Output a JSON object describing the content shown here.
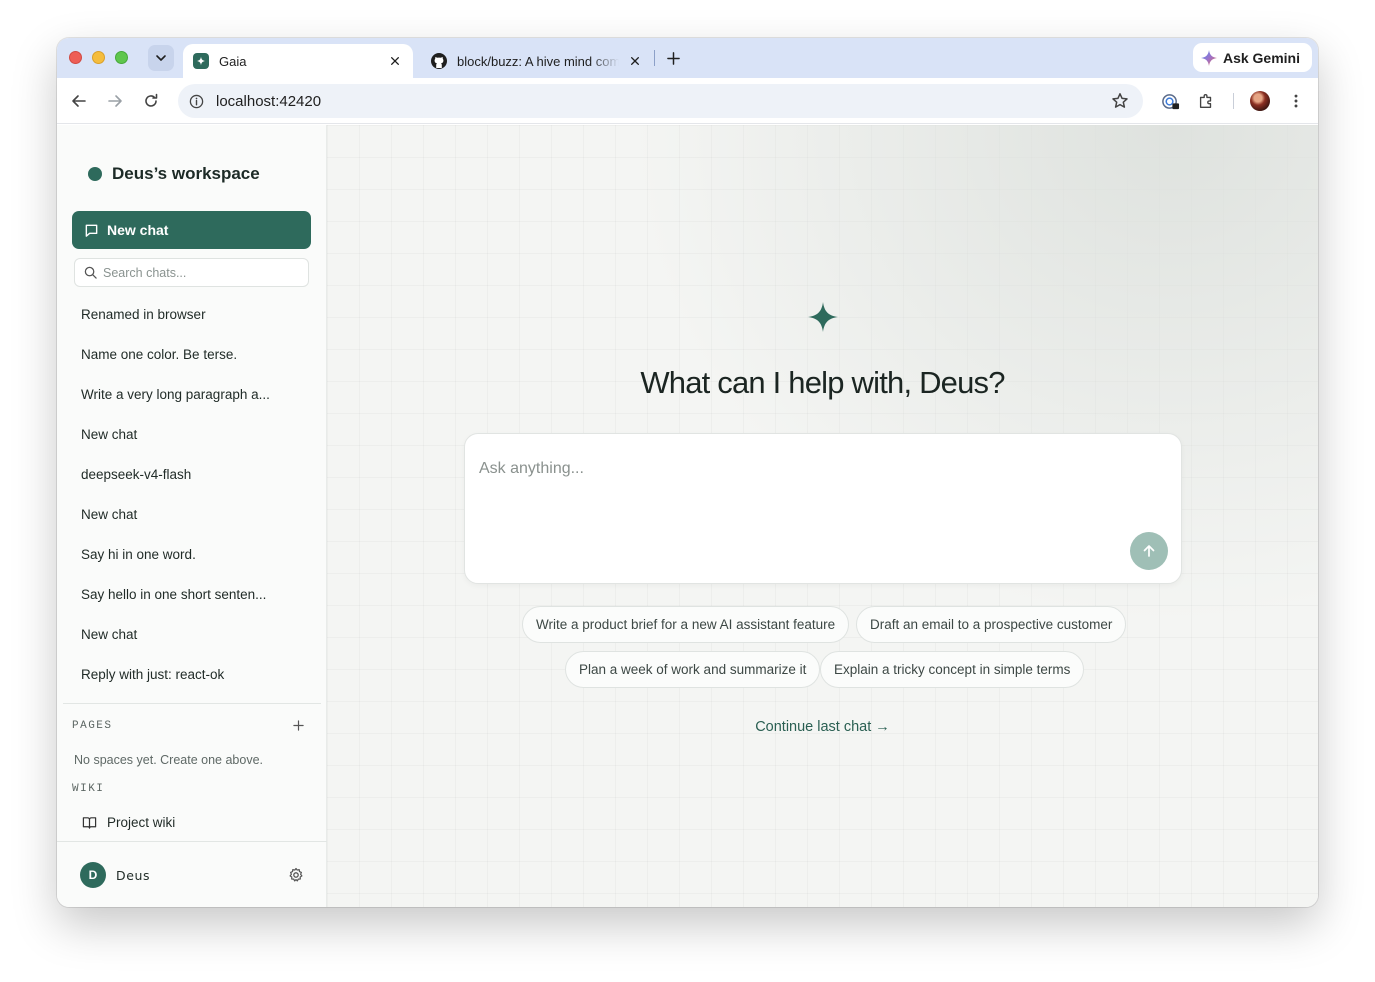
{
  "browser": {
    "tabs": [
      {
        "title": "Gaia"
      },
      {
        "title": "block/buzz: A hive mind comm"
      }
    ],
    "gemini_label": "Ask Gemini",
    "url": "localhost:42420"
  },
  "sidebar": {
    "workspace_name": "Deus’s workspace",
    "new_chat_label": "New chat",
    "search_placeholder": "Search chats...",
    "chats": [
      "Renamed in browser",
      "Name one color. Be terse.",
      "Write a very long paragraph a...",
      "New chat",
      "deepseek-v4-flash",
      "New chat",
      "Say hi in one word.",
      "Say hello in one short senten...",
      "New chat",
      "Reply with just: react-ok"
    ],
    "pages_label": "PAGES",
    "pages_empty": "No spaces yet. Create one above.",
    "wiki_label": "WIKI",
    "wiki_item": "Project wiki",
    "user_initial": "D",
    "user_name": "Deus"
  },
  "main": {
    "heading": "What can I help with, Deus?",
    "composer_placeholder": "Ask anything...",
    "suggestions": [
      "Write a product brief for a new AI assistant feature",
      "Draft an email to a prospective customer",
      "Plan a week of work and summarize it",
      "Explain a tricky concept in simple terms"
    ],
    "continue_label": "Continue last chat →"
  },
  "colors": {
    "accent": "#2e6a5c",
    "send_disabled": "#9fbfb6",
    "tabstrip": "#d9e3f7"
  }
}
